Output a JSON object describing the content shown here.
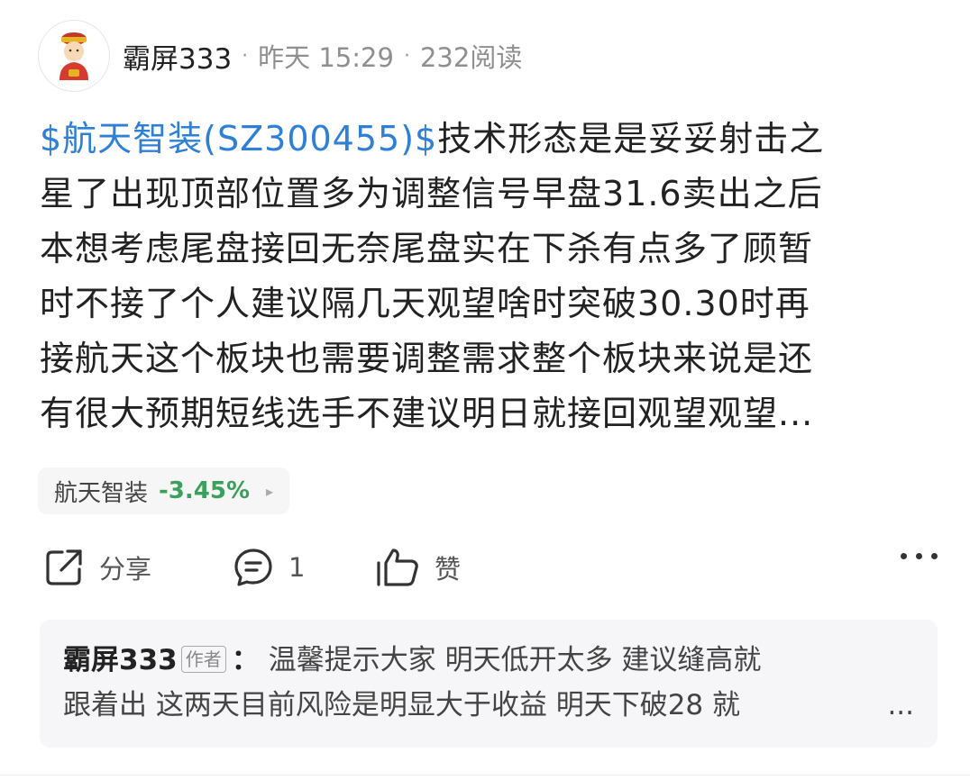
{
  "header": {
    "username": "霸屏333",
    "separator": "·",
    "time": "昨天 15:29",
    "reads": "232阅读",
    "avatar_icon": "fortune-god-avatar-icon"
  },
  "post": {
    "stock_link": "$航天智装(SZ300455)$",
    "lines": [
      "技术形态是是妥妥射击之",
      "星了出现顶部位置多为调整信号早盘31.6卖出之后",
      "本想考虑尾盘接回无奈尾盘实在下杀有点多了顾暂",
      "时不接了个人建议隔几天观望啥时突破30.30时再",
      "接航天这个板块也需要调整需求整个板块来说是还",
      "有很大预期短线选手不建议明日就接回观望观望..."
    ]
  },
  "stock_chip": {
    "name": "航天智装",
    "change": "-3.45%",
    "change_color": "#3aa05c",
    "arrow": "▸"
  },
  "actions": {
    "share_label": "分享",
    "comment_count": "1",
    "like_label": "赞",
    "share_icon": "share-icon",
    "comment_icon": "comment-icon",
    "like_icon": "thumbs-up-icon",
    "more_icon": "more-icon"
  },
  "comment": {
    "author": "霸屏333",
    "author_tag": "作者",
    "colon": "：",
    "line1": "温馨提示大家 明天低开太多 建议缝高就",
    "line2": "跟着出 这两天目前风险是明显大于收益 明天下破28 就",
    "ellipsis": "..."
  },
  "colors": {
    "link": "#2e7fd6",
    "text": "#222222",
    "muted": "#8f8f8f",
    "chip_bg": "#f6f6f6",
    "comment_bg": "#f6f6f8"
  }
}
